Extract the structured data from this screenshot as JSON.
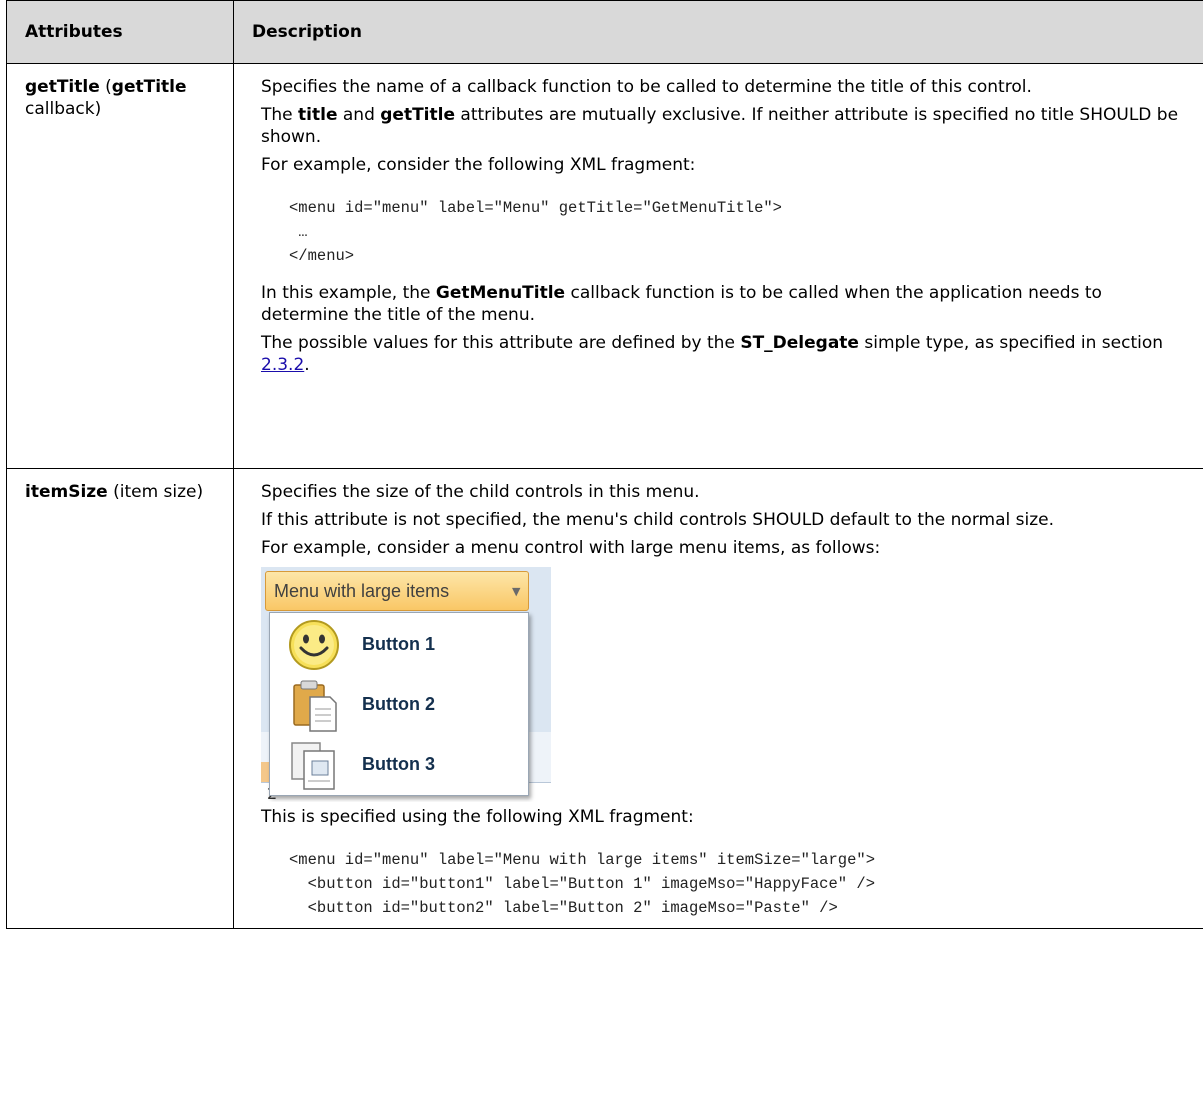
{
  "table": {
    "headers": [
      "Attributes",
      "Description"
    ],
    "row1": {
      "name_bold1": "getTitle",
      "name_plain1": " (",
      "name_bold2": "getTitle",
      "name_plain2": " callback)",
      "p1": "Specifies the name of a callback function to be called to determine the title of this control.",
      "p2_pre": "The ",
      "p2_b1": "title",
      "p2_mid": " and ",
      "p2_b2": "getTitle",
      "p2_post": " attributes are mutually exclusive. If neither attribute is specified no title SHOULD be shown.",
      "p3": "For example, consider the following XML fragment:",
      "code": [
        "<menu id=\"menu\" label=\"Menu\" getTitle=\"GetMenuTitle\">",
        " …",
        "</menu>"
      ],
      "p4_pre": "In this example, the ",
      "p4_b": "GetMenuTitle",
      "p4_post": " callback function is to be called when the application needs to determine the title of the menu.",
      "p5_pre": "The possible values for this attribute are defined by the ",
      "p5_b": "ST_Delegate",
      "p5_mid": " simple type, as specified in section ",
      "p5_link": "2.3.2",
      "p5_post": "."
    },
    "row2": {
      "name_bold": "itemSize",
      "name_plain": " (item size)",
      "p1": "Specifies the size of the child controls in this menu.",
      "p2": "If this attribute is not specified, the menu's child controls SHOULD default to the normal size.",
      "p3": "For example, consider a menu control with large menu items, as follows:",
      "screenshot": {
        "menu_label": "Menu with large items",
        "items": [
          "Button 1",
          "Button 2",
          "Button 3"
        ],
        "cell_text": "2"
      },
      "p4": "This is specified using the following XML fragment:",
      "code": [
        "<menu id=\"menu\" label=\"Menu with large items\" itemSize=\"large\">",
        "  <button id=\"button1\" label=\"Button 1\" imageMso=\"HappyFace\" />",
        "  <button id=\"button2\" label=\"Button 2\" imageMso=\"Paste\" />"
      ]
    }
  }
}
